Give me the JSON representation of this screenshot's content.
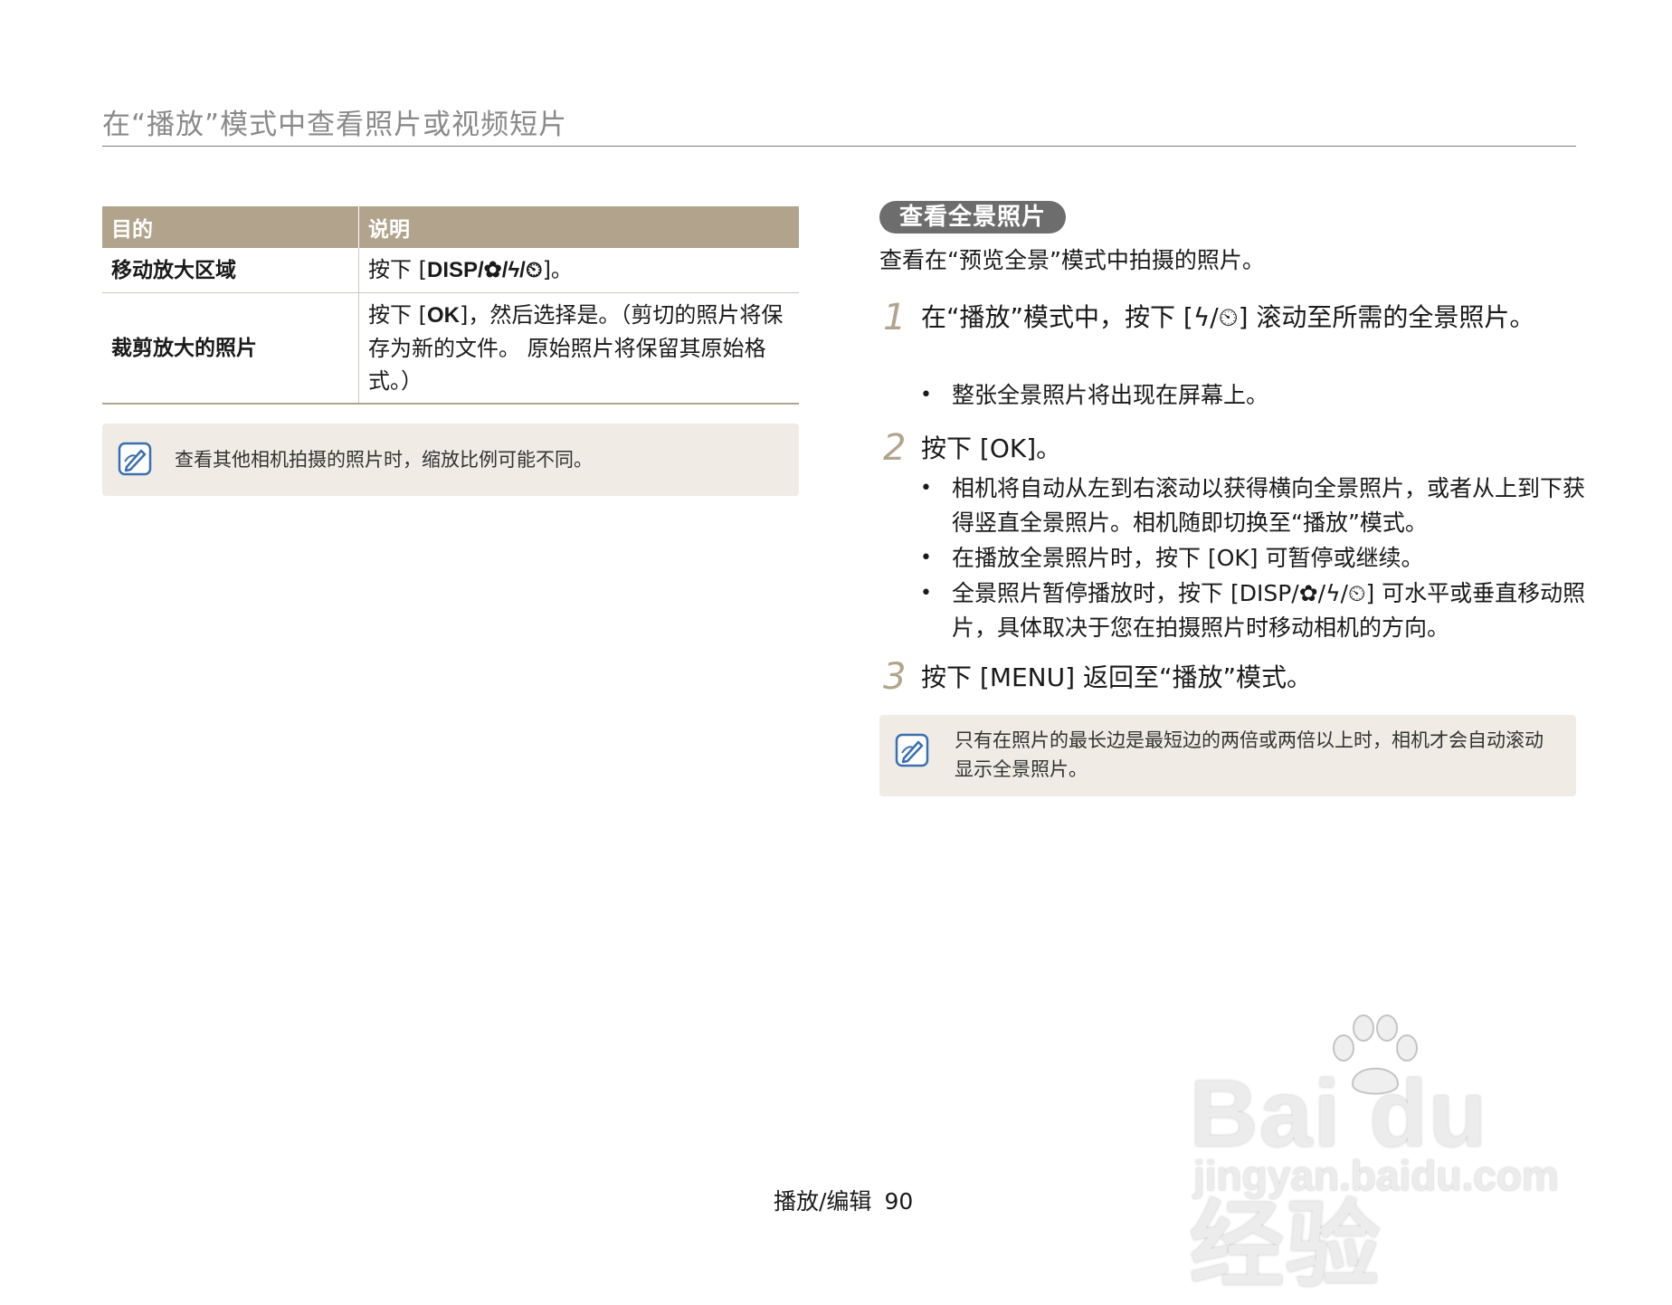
{
  "header": {
    "title": "在“播放”模式中查看照片或视频短片"
  },
  "table": {
    "headers": [
      "目的",
      "说明"
    ],
    "rows": [
      {
        "purpose": "移动放大区域",
        "desc_pre": "按下 [",
        "desc_keys": "DISP/✿/ϟ/⏲",
        "desc_post": "]。"
      },
      {
        "purpose": "裁剪放大的照片",
        "desc_pre": "按下 [",
        "desc_keys": "OK",
        "desc_post": "]，然后选择是。（剪切的照片将保存为新的文件。 原始照片将保留其原始格式。）"
      }
    ]
  },
  "note_left": {
    "text": "查看其他相机拍摄的照片时，缩放比例可能不同。",
    "icon": "note-pencil-icon"
  },
  "section": {
    "title": "查看全景照片",
    "intro": "查看在“预览全景”模式中拍摄的照片。",
    "steps": [
      {
        "num": "1",
        "text": "在“播放”模式中，按下 [ϟ/⏲] 滚动至所需的全景照片。",
        "bullets": [
          "整张全景照片将出现在屏幕上。"
        ]
      },
      {
        "num": "2",
        "text": "按下 [OK]。",
        "bullets": [
          "相机将自动从左到右滚动以获得横向全景照片，或者从上到下获得竖直全景照片。相机随即切换至“播放”模式。",
          "在播放全景照片时，按下 [OK] 可暂停或继续。",
          "全景照片暂停播放时，按下 [DISP/✿/ϟ/⏲] 可水平或垂直移动照片，具体取决于您在拍摄照片时移动相机的方向。"
        ]
      },
      {
        "num": "3",
        "text": "按下 [MENU] 返回至“播放”模式。",
        "bullets": []
      }
    ]
  },
  "note_right": {
    "text": "只有在照片的最长边是最短边的两倍或两倍以上时，相机才会自动滚动显示全景照片。",
    "icon": "note-pencil-icon"
  },
  "footer": {
    "section": "播放/编辑",
    "page": "90"
  },
  "watermark": {
    "brand": "Bai du 经验",
    "url": "jingyan.baidu.com"
  },
  "colors": {
    "accent": "#b2a48c",
    "pill": "#6d6d6d",
    "note_bg": "#f0ece5",
    "header_text": "#8a8a8a"
  }
}
